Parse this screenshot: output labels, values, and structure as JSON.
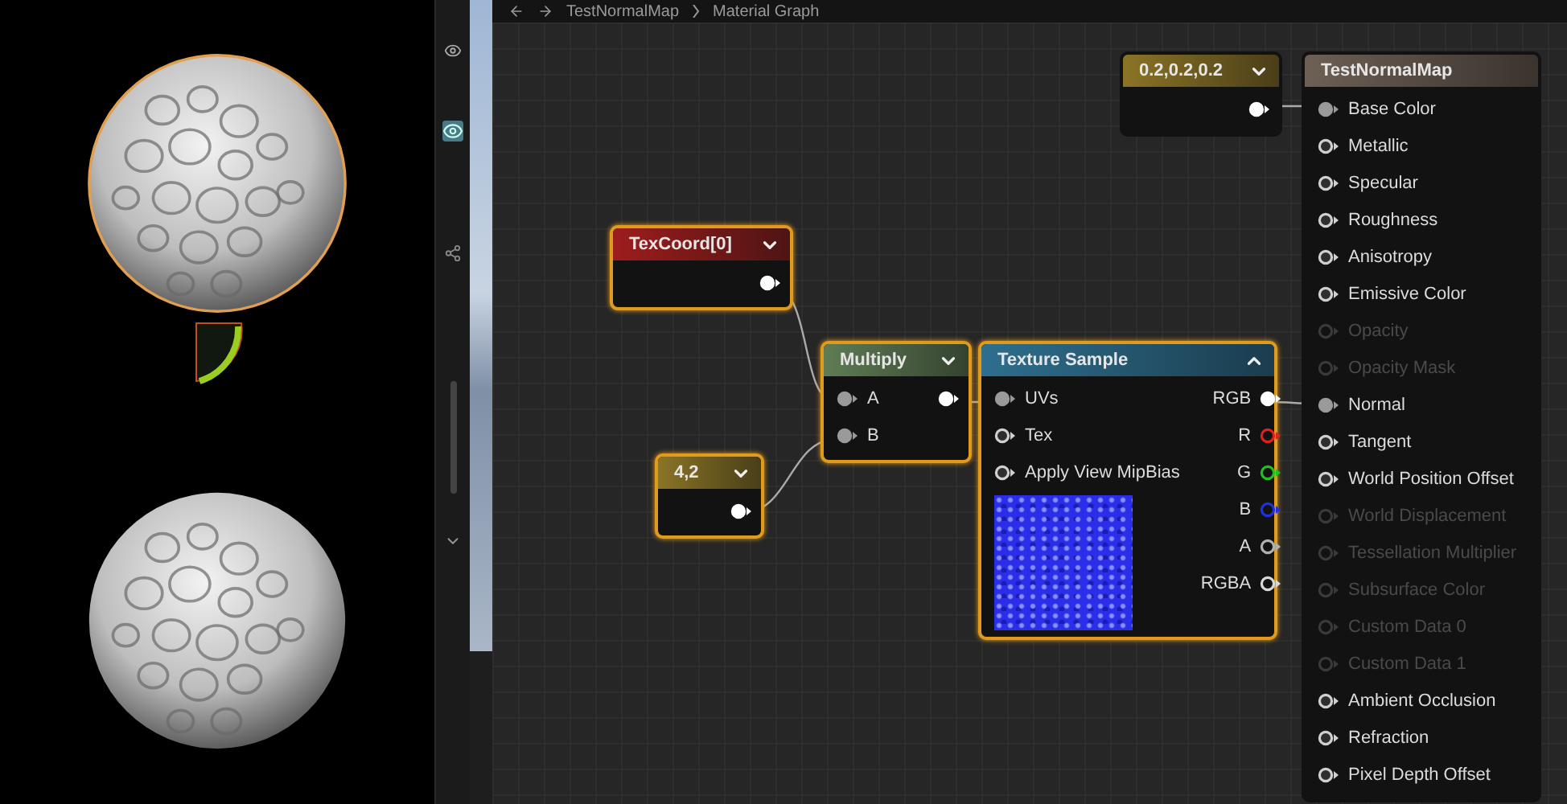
{
  "breadcrumb": [
    "TestNormalMap",
    "Material Graph"
  ],
  "nodes": [
    {
      "kind": "texcoord",
      "title": "TexCoord[0]",
      "selected": true,
      "expanded": false,
      "outputs": [
        {
          "connected": true,
          "color": "#ffffff"
        }
      ]
    },
    {
      "kind": "constant",
      "title": "4,2",
      "selected": true,
      "expanded": false,
      "outputs": [
        {
          "connected": true,
          "color": "#ffffff"
        }
      ]
    },
    {
      "kind": "math",
      "title": "Multiply",
      "selected": true,
      "expanded": false,
      "inputs": [
        {
          "label": "A",
          "connected": true
        },
        {
          "label": "B",
          "connected": true
        }
      ],
      "outputs": [
        {
          "connected": true,
          "color": "#ffffff"
        }
      ]
    },
    {
      "kind": "constant",
      "title": "0.2,0.2,0.2",
      "selected": false,
      "expanded": false,
      "outputs": [
        {
          "connected": true,
          "color": "#ffffff"
        }
      ]
    },
    {
      "kind": "texture",
      "title": "Texture Sample",
      "selected": true,
      "expanded": true,
      "inputs": [
        {
          "label": "UVs",
          "connected": true
        },
        {
          "label": "Tex",
          "connected": false
        },
        {
          "label": "Apply View MipBias",
          "connected": false
        }
      ],
      "outputs": [
        {
          "label": "RGB",
          "connected": true,
          "color": "#ffffff"
        },
        {
          "label": "R",
          "connected": false,
          "color": "#e02020"
        },
        {
          "label": "G",
          "connected": false,
          "color": "#20c020"
        },
        {
          "label": "B",
          "connected": false,
          "color": "#2030e0"
        },
        {
          "label": "A",
          "connected": false,
          "color": "#b0b0b0"
        },
        {
          "label": "RGBA",
          "connected": false,
          "color": "#d8d8d8"
        }
      ]
    },
    {
      "kind": "result",
      "title": "TestNormalMap",
      "selected": false,
      "inputs": [
        {
          "label": "Base Color",
          "connected": true,
          "disabled": false
        },
        {
          "label": "Metallic",
          "connected": false,
          "disabled": false
        },
        {
          "label": "Specular",
          "connected": false,
          "disabled": false
        },
        {
          "label": "Roughness",
          "connected": false,
          "disabled": false
        },
        {
          "label": "Anisotropy",
          "connected": false,
          "disabled": false
        },
        {
          "label": "Emissive Color",
          "connected": false,
          "disabled": false
        },
        {
          "label": "Opacity",
          "connected": false,
          "disabled": true
        },
        {
          "label": "Opacity Mask",
          "connected": false,
          "disabled": true
        },
        {
          "label": "Normal",
          "connected": true,
          "disabled": false
        },
        {
          "label": "Tangent",
          "connected": false,
          "disabled": false
        },
        {
          "label": "World Position Offset",
          "connected": false,
          "disabled": false
        },
        {
          "label": "World Displacement",
          "connected": false,
          "disabled": true
        },
        {
          "label": "Tessellation Multiplier",
          "connected": false,
          "disabled": true
        },
        {
          "label": "Subsurface Color",
          "connected": false,
          "disabled": true
        },
        {
          "label": "Custom Data 0",
          "connected": false,
          "disabled": true
        },
        {
          "label": "Custom Data 1",
          "connected": false,
          "disabled": true
        },
        {
          "label": "Ambient Occlusion",
          "connected": false,
          "disabled": false
        },
        {
          "label": "Refraction",
          "connected": false,
          "disabled": false
        },
        {
          "label": "Pixel Depth Offset",
          "connected": false,
          "disabled": false
        }
      ]
    }
  ]
}
